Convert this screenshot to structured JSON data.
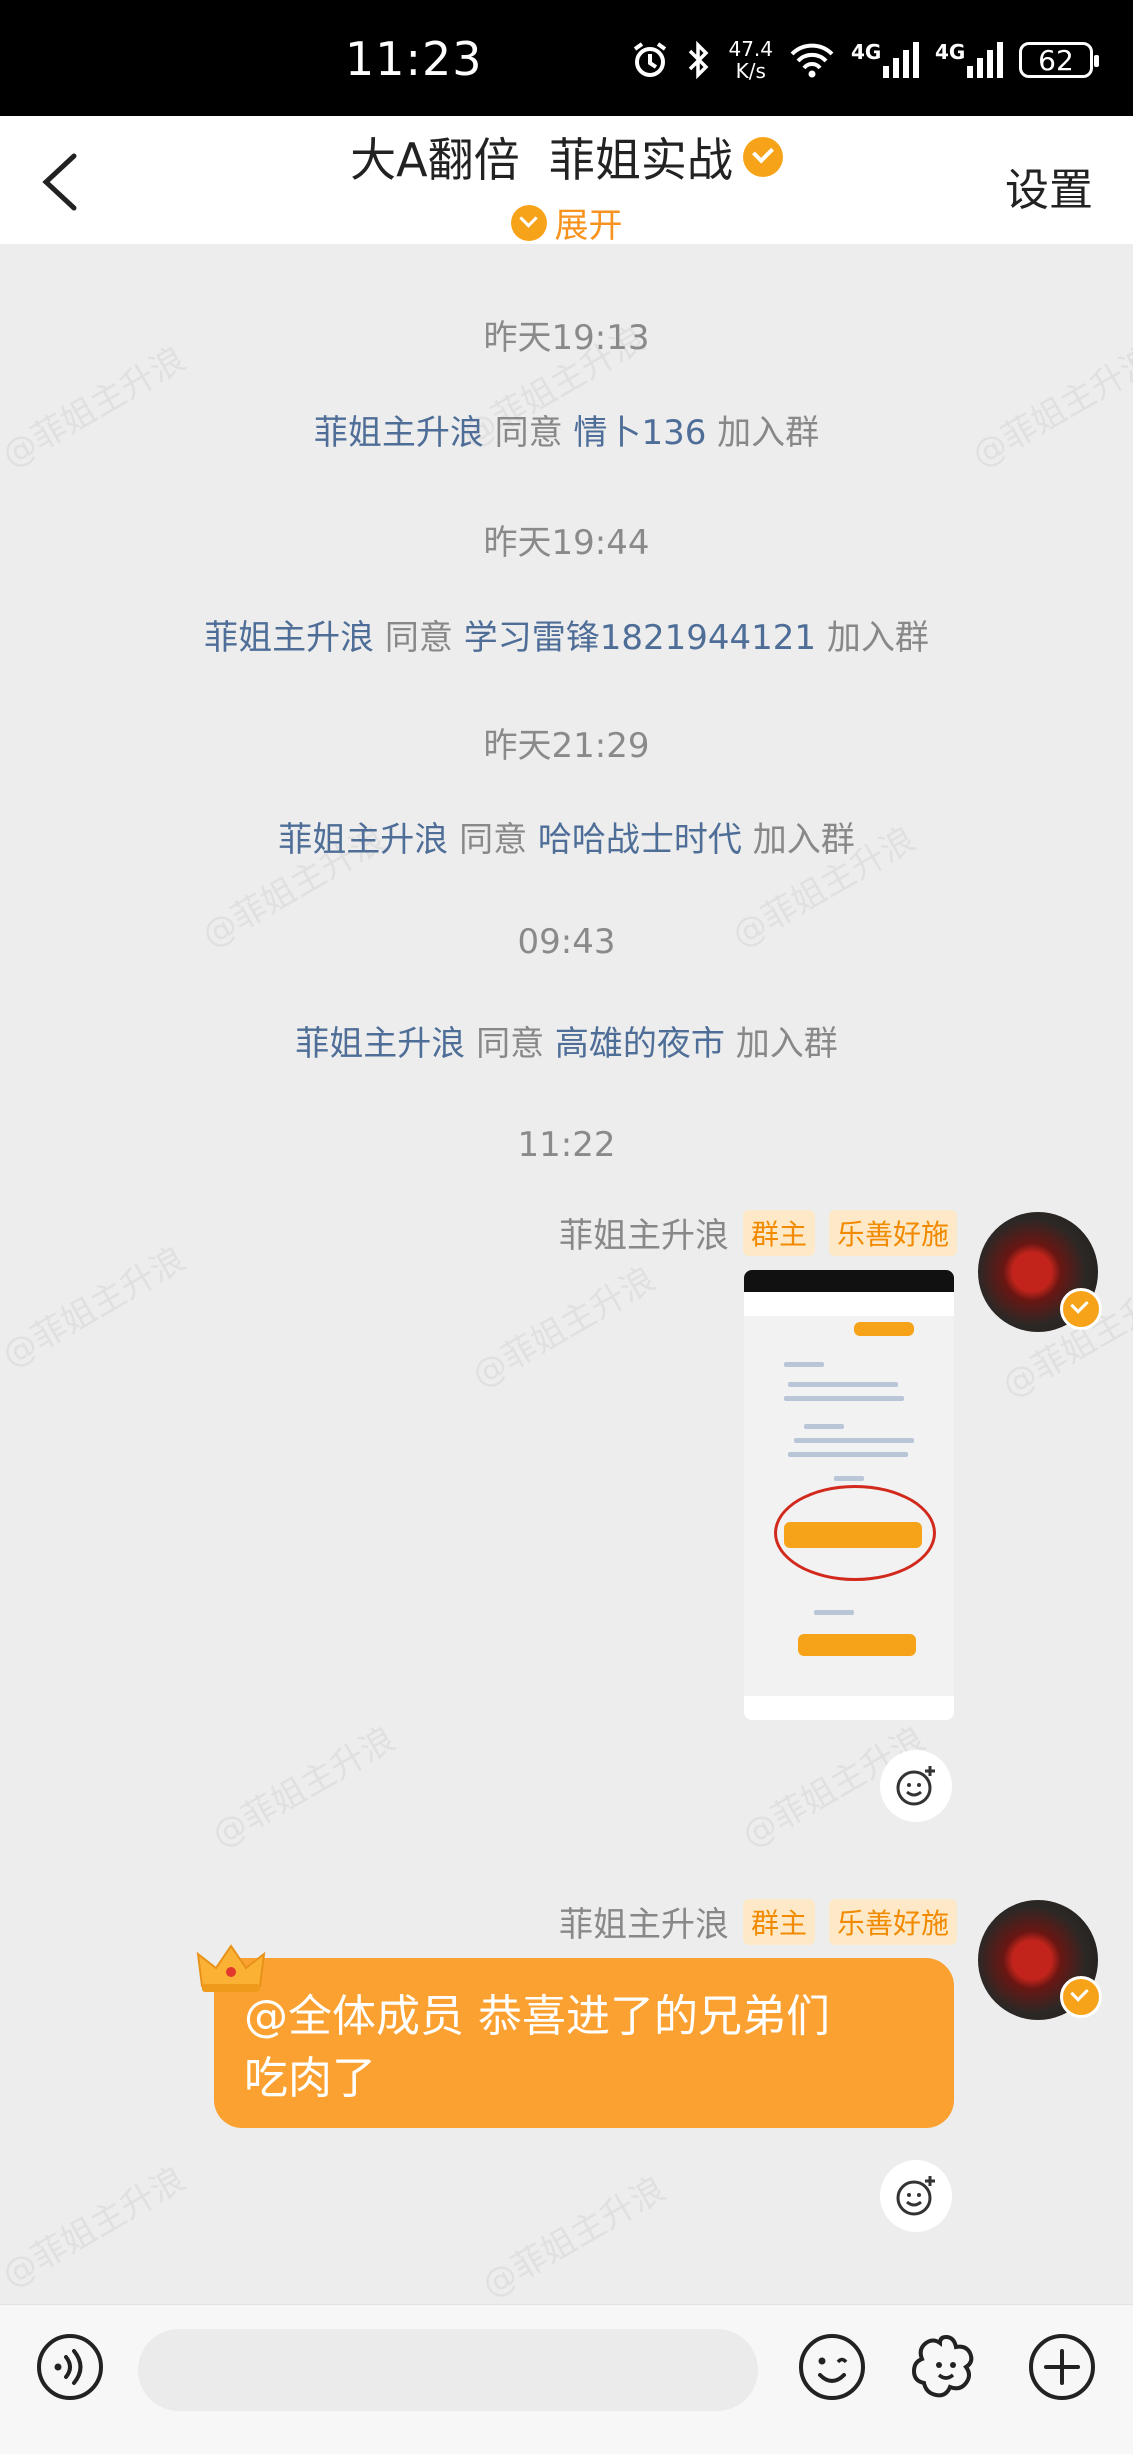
{
  "status_bar": {
    "time": "11:23",
    "net_speed_top": "47.4",
    "net_speed_unit": "K/s",
    "sim1": "4G",
    "sim2": "4G",
    "battery": "62"
  },
  "header": {
    "title": "大A翻倍  菲姐实战",
    "expand_label": "展开",
    "settings_label": "设置"
  },
  "events": [
    {
      "time": "昨天19:13",
      "actor": "菲姐主升浪",
      "verb": "同意",
      "target": "情卜136",
      "suffix": "加入群"
    },
    {
      "time": "昨天19:44",
      "actor": "菲姐主升浪",
      "verb": "同意",
      "target": "学习雷锋1821944121",
      "suffix": "加入群"
    },
    {
      "time": "昨天21:29",
      "actor": "菲姐主升浪",
      "verb": "同意",
      "target": "哈哈战士时代",
      "suffix": "加入群"
    },
    {
      "time": "09:43",
      "actor": "菲姐主升浪",
      "verb": "同意",
      "target": "高雄的夜市",
      "suffix": "加入群"
    }
  ],
  "last_time": "11:22",
  "messages": [
    {
      "sender": "菲姐主升浪",
      "tag1": "群主",
      "tag2": "乐善好施",
      "type": "image"
    },
    {
      "sender": "菲姐主升浪",
      "tag1": "群主",
      "tag2": "乐善好施",
      "type": "text",
      "line1": "@全体成员 恭喜进了的兄弟们",
      "line2": "吃肉了"
    }
  ],
  "watermark": "@菲姐主升浪",
  "colors": {
    "accent": "#fba131",
    "name_blue": "#4e6e98",
    "bg": "#ededed"
  }
}
